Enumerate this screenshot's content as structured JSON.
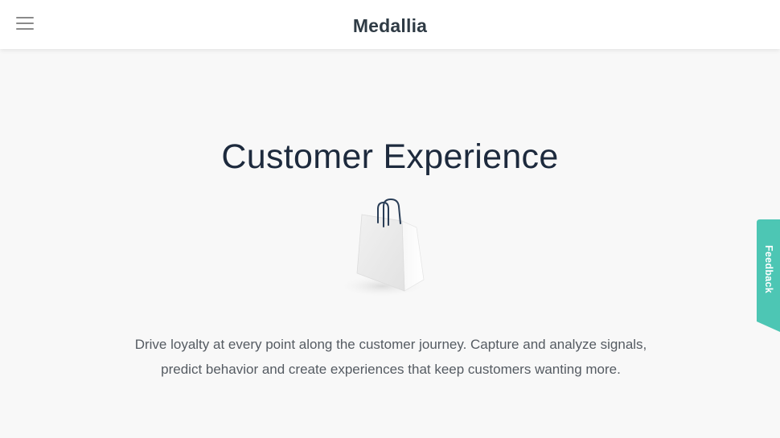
{
  "header": {
    "logo_text": "Medallia",
    "menu_icon": "hamburger-menu-icon"
  },
  "hero": {
    "title": "Customer Experience",
    "illustration": "shopping-bag-icon",
    "description": "Drive loyalty at every point along the customer journey. Capture and analyze signals, predict behavior and create experiences that keep customers wanting more."
  },
  "feedback": {
    "label": "Feedback",
    "color": "#4dc6b4"
  },
  "colors": {
    "page_background": "#f8f8f8",
    "header_background": "#ffffff",
    "title_text": "#1d2a3d",
    "body_text": "#555b62",
    "logo_text": "#2f3b45"
  }
}
